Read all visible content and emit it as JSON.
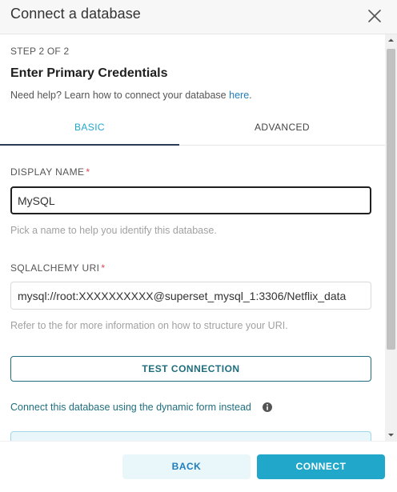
{
  "modal": {
    "title": "Connect a database",
    "close_icon": "close-icon"
  },
  "step": {
    "label": "STEP 2 OF 2",
    "title": "Enter Primary Credentials",
    "help_text": "Need help? Learn how to connect your database",
    "help_link": "here",
    "help_suffix": "."
  },
  "tabs": [
    {
      "label": "BASIC",
      "active": true
    },
    {
      "label": "ADVANCED",
      "active": false
    }
  ],
  "display_name": {
    "label": "DISPLAY NAME",
    "required_mark": "*",
    "value": "MySQL",
    "hint": "Pick a name to help you identify this database."
  },
  "sqlalchemy_uri": {
    "label": "SQLALCHEMY URI",
    "required_mark": "*",
    "value": "mysql://root:XXXXXXXXXX@superset_mysql_1:3306/Netflix_data",
    "hint": "Refer to the for more information on how to structure your URI."
  },
  "test_connection": {
    "label": "TEST CONNECTION"
  },
  "dynamic_form_link": {
    "label": "Connect this database using the dynamic form instead",
    "icon": "info-icon"
  },
  "footer": {
    "back_label": "BACK",
    "connect_label": "CONNECT"
  },
  "colors": {
    "accent": "#20a7c9",
    "tab_underline": "#2b3a55",
    "teal_text": "#1f6e7e",
    "required": "#e04355"
  }
}
